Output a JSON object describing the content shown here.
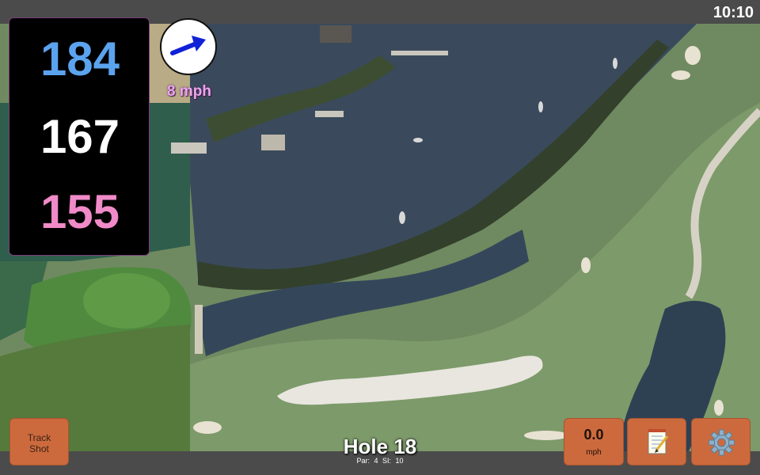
{
  "status": {
    "clock": "10:10"
  },
  "distances": {
    "back": "184",
    "middle": "167",
    "front": "155"
  },
  "wind": {
    "speed": "8 mph",
    "icon": "wind-arrow-icon"
  },
  "hole": {
    "title": "Hole 18",
    "par": "Par: 4",
    "si": "SI: 10"
  },
  "buttons": {
    "track_shot_line1": "Track",
    "track_shot_line2": "Shot",
    "speed_value": "0.0",
    "speed_unit": "mph",
    "notes_icon": "notepad-icon",
    "settings_icon": "gear-icon"
  },
  "colors": {
    "back": "#5ba3ee",
    "middle": "#ffffff",
    "front": "#f08ac8",
    "button": "#cc6a3e",
    "wind_text": "#e7a8ec"
  }
}
